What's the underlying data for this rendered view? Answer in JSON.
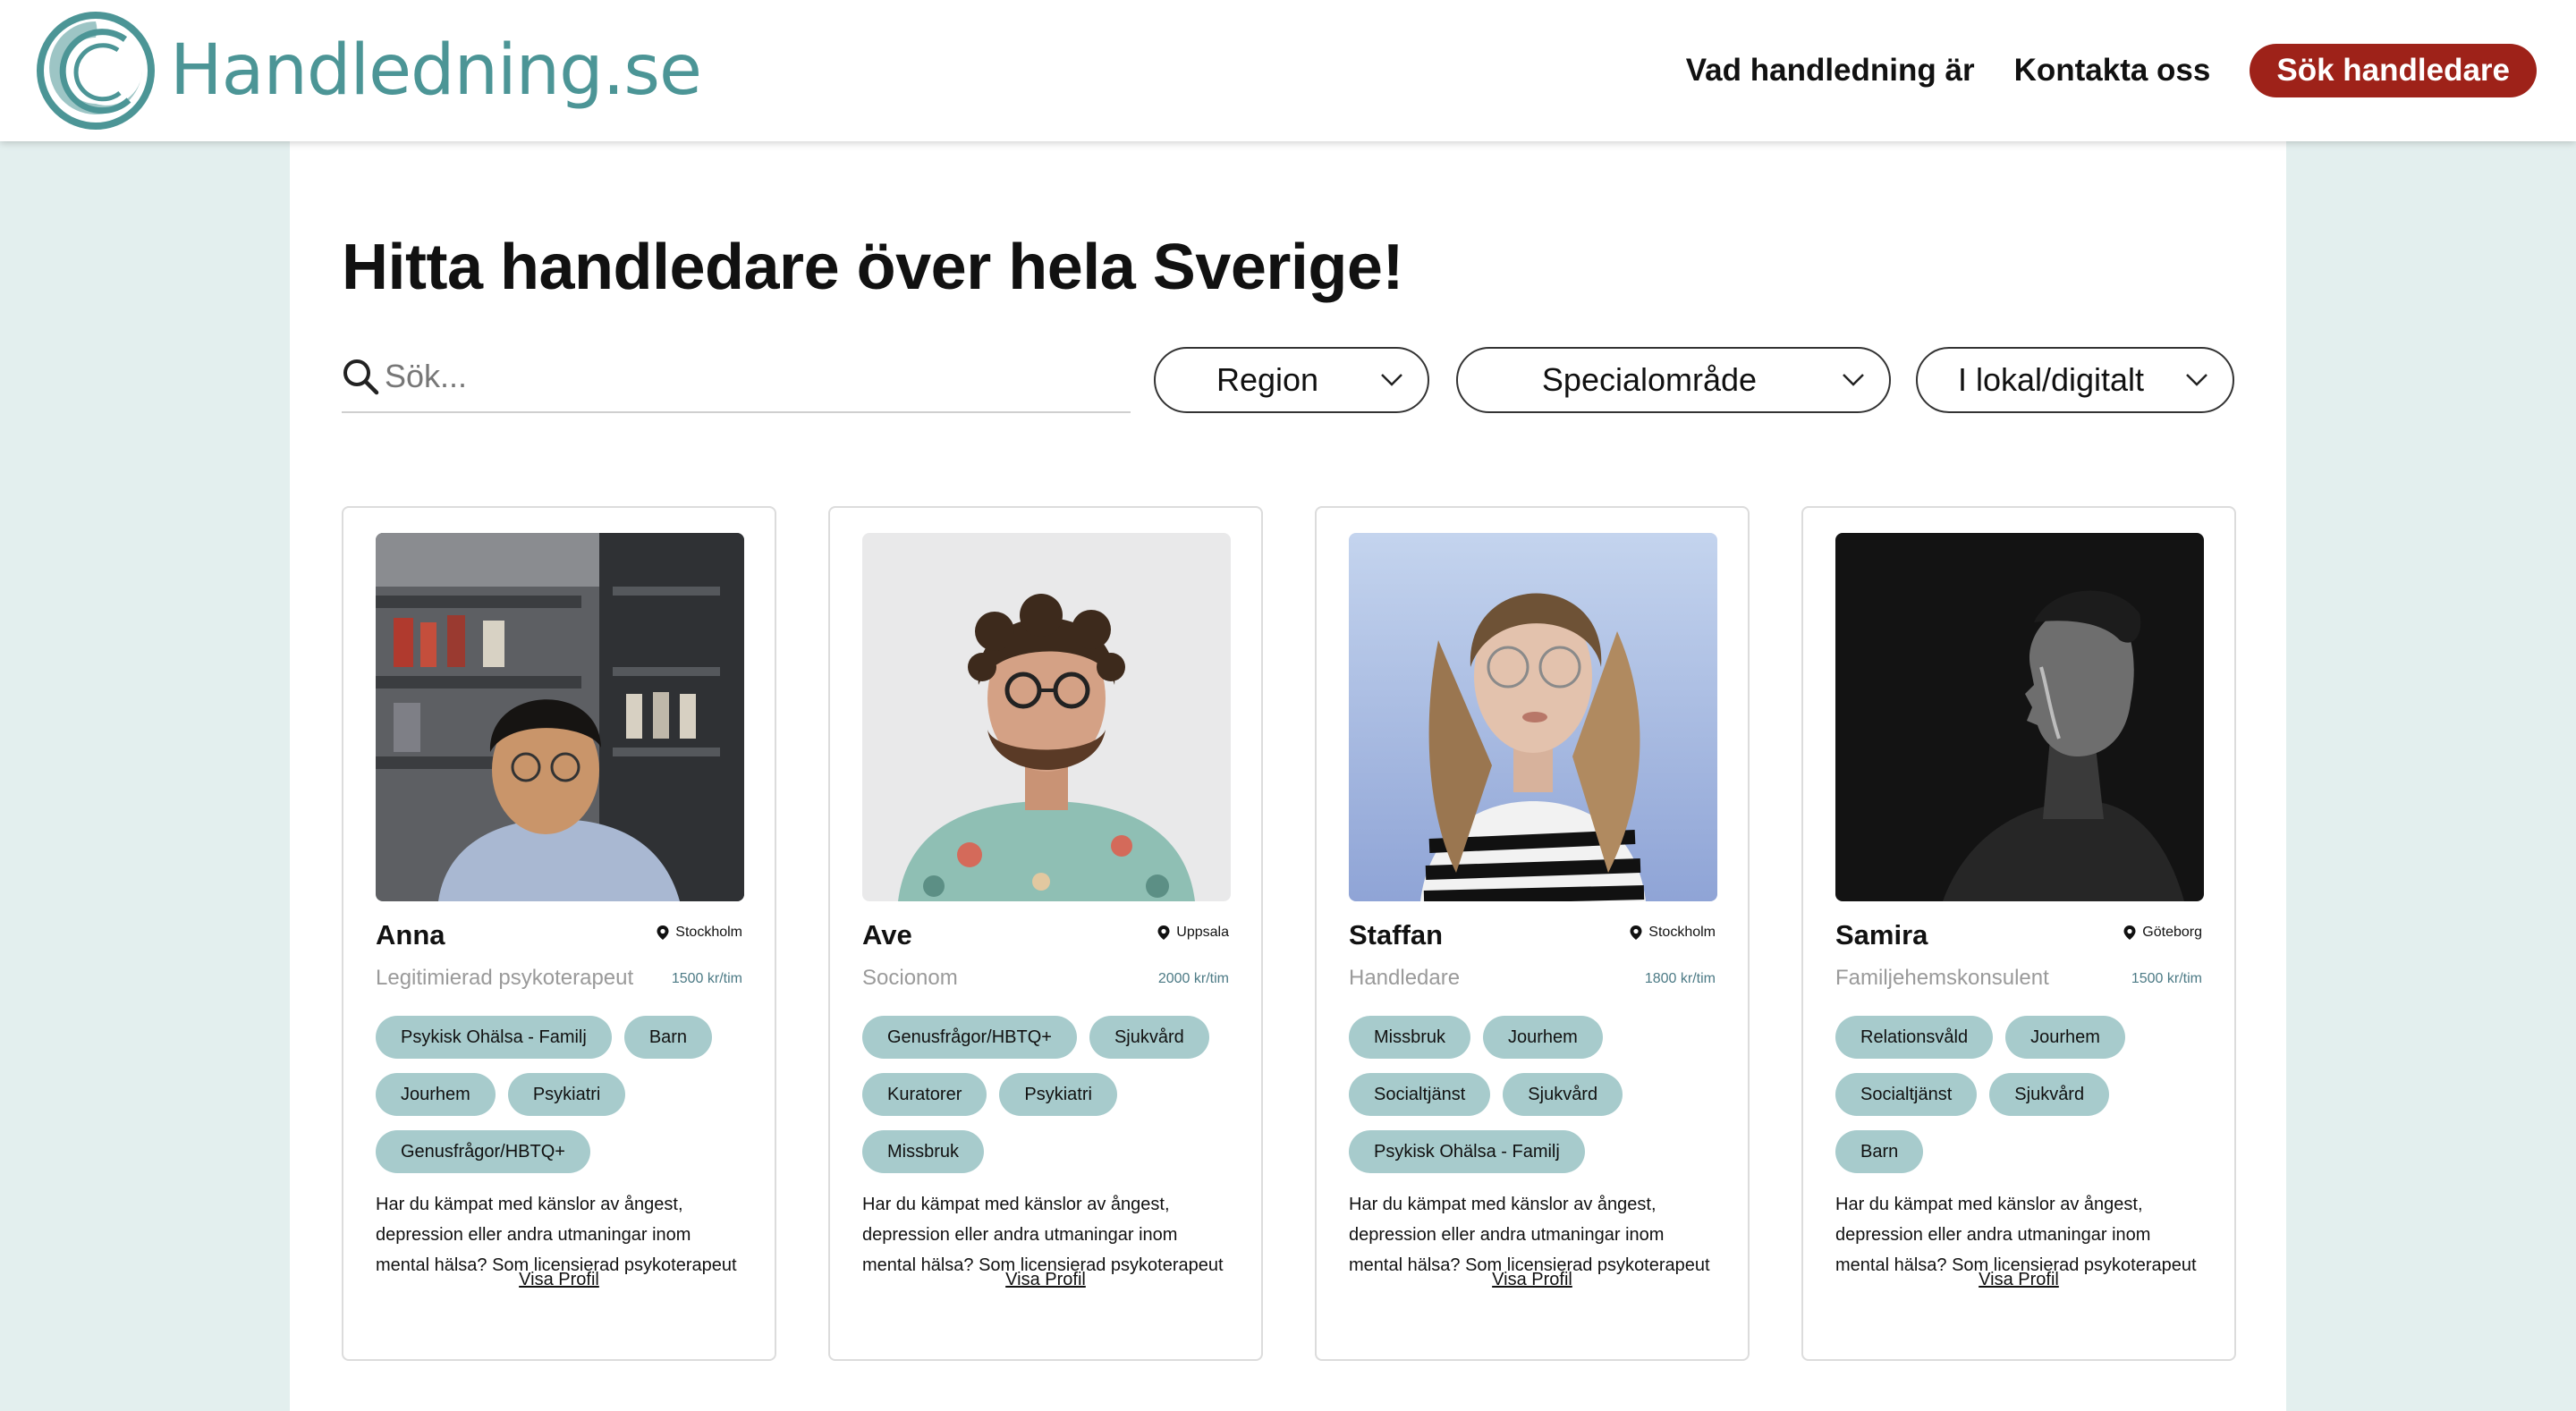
{
  "header": {
    "logo_text": "Handledning.se",
    "nav": [
      "Vad handledning är",
      "Kontakta oss"
    ],
    "cta": "Sök handledare"
  },
  "main": {
    "title": "Hitta handledare över hela Sverige!",
    "search_placeholder": "Sök...",
    "filters": [
      "Region",
      "Specialområde",
      "I lokal/digitalt"
    ]
  },
  "cards": [
    {
      "name": "Anna",
      "location": "Stockholm",
      "role": "Legitimierad psykoterapeut",
      "price": "1500 kr/tim",
      "tags": [
        "Psykisk Ohälsa - Familj",
        "Barn",
        "Jourhem",
        "Psykiatri",
        "Genusfrågor/HBTQ+"
      ],
      "desc": [
        "Har du kämpat med känslor av ångest,",
        "depression eller andra utmaningar inom",
        "mental hälsa? Som licensierad psykoterapeut"
      ],
      "link": "Visa Profil"
    },
    {
      "name": "Ave",
      "location": "Uppsala",
      "role": "Socionom",
      "price": "2000 kr/tim",
      "tags": [
        "Genusfrågor/HBTQ+",
        "Sjukvård",
        "Kuratorer",
        "Psykiatri",
        "Missbruk"
      ],
      "desc": [
        "Har du kämpat med känslor av ångest,",
        "depression eller andra utmaningar inom",
        "mental hälsa? Som licensierad psykoterapeut"
      ],
      "link": "Visa Profil"
    },
    {
      "name": "Staffan",
      "location": "Stockholm",
      "role": "Handledare",
      "price": "1800 kr/tim",
      "tags": [
        "Missbruk",
        "Jourhem",
        "Socialtjänst",
        "Sjukvård",
        "Psykisk Ohälsa - Familj"
      ],
      "desc": [
        "Har du kämpat med känslor av ångest,",
        "depression eller andra utmaningar inom",
        "mental hälsa? Som licensierad psykoterapeut"
      ],
      "link": "Visa Profil"
    },
    {
      "name": "Samira",
      "location": "Göteborg",
      "role": "Familjehemskonsulent",
      "price": "1500 kr/tim",
      "tags": [
        "Relationsvåld",
        "Jourhem",
        "Socialtjänst",
        "Sjukvård",
        "Barn"
      ],
      "desc": [
        "Har du kämpat med känslor av ångest,",
        "depression eller andra utmaningar inom",
        "mental hälsa? Som licensierad psykoterapeut"
      ],
      "link": "Visa Profil"
    }
  ],
  "colors": {
    "brand_teal": "#4c9596",
    "cta_red": "#9e2219",
    "tag_bg": "#a7cbcc",
    "page_bg": "#e3efee"
  }
}
